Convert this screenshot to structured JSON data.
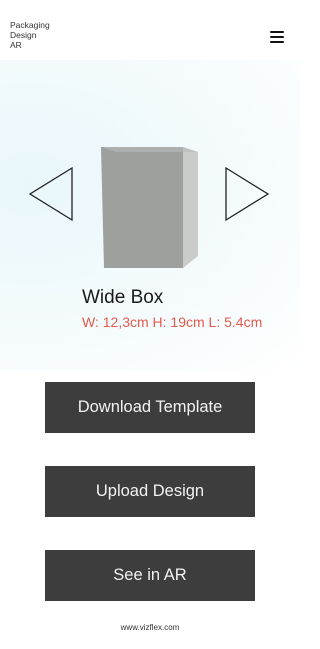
{
  "header": {
    "title_line1": "Packaging",
    "title_line2": "Design",
    "title_line3": "AR",
    "menu_icon": "hamburger-menu-icon"
  },
  "carousel": {
    "prev_icon": "chevron-left-outline-icon",
    "next_icon": "chevron-right-outline-icon",
    "box_colors": {
      "front": "#9da09d",
      "side": "#c9ccc9",
      "top": "#b8bbb8"
    }
  },
  "product": {
    "name": "Wide Box",
    "dimensions": "W: 12,3cm H: 19cm L: 5.4cm"
  },
  "actions": {
    "download_label": "Download Template",
    "upload_label": "Upload Design",
    "ar_label": "See in AR"
  },
  "footer": {
    "link_text": "www.vizflex.com"
  },
  "colors": {
    "button_bg": "#3d3d3d",
    "button_text": "#f2f2f2",
    "dimensions_text": "#e25a4d",
    "hero_tint": "#e9f7fb"
  }
}
